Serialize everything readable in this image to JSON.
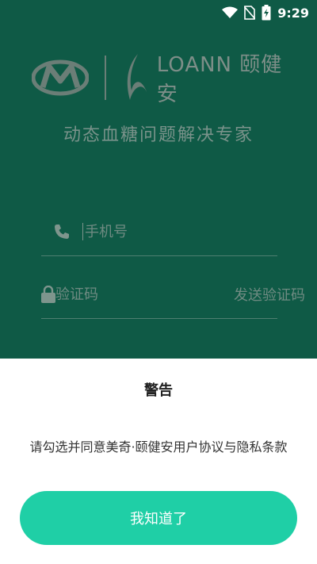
{
  "status_bar": {
    "time": "9:29",
    "icons": [
      "wifi-icon",
      "no-sim-icon",
      "battery-charging-icon"
    ]
  },
  "logo": {
    "brand_text": "LOANN 颐健安"
  },
  "tagline": "动态血糖问题解决专家",
  "form": {
    "phone_placeholder": "手机号",
    "code_placeholder": "验证码",
    "send_code_label": "发送验证码"
  },
  "dialog": {
    "title": "警告",
    "message": "请勾选并同意美奇·颐健安用户协议与隐私条款",
    "button_label": "我知道了"
  },
  "colors": {
    "background": "#0f5a46",
    "accent": "#1fcfa6",
    "sheet": "#ffffff"
  }
}
